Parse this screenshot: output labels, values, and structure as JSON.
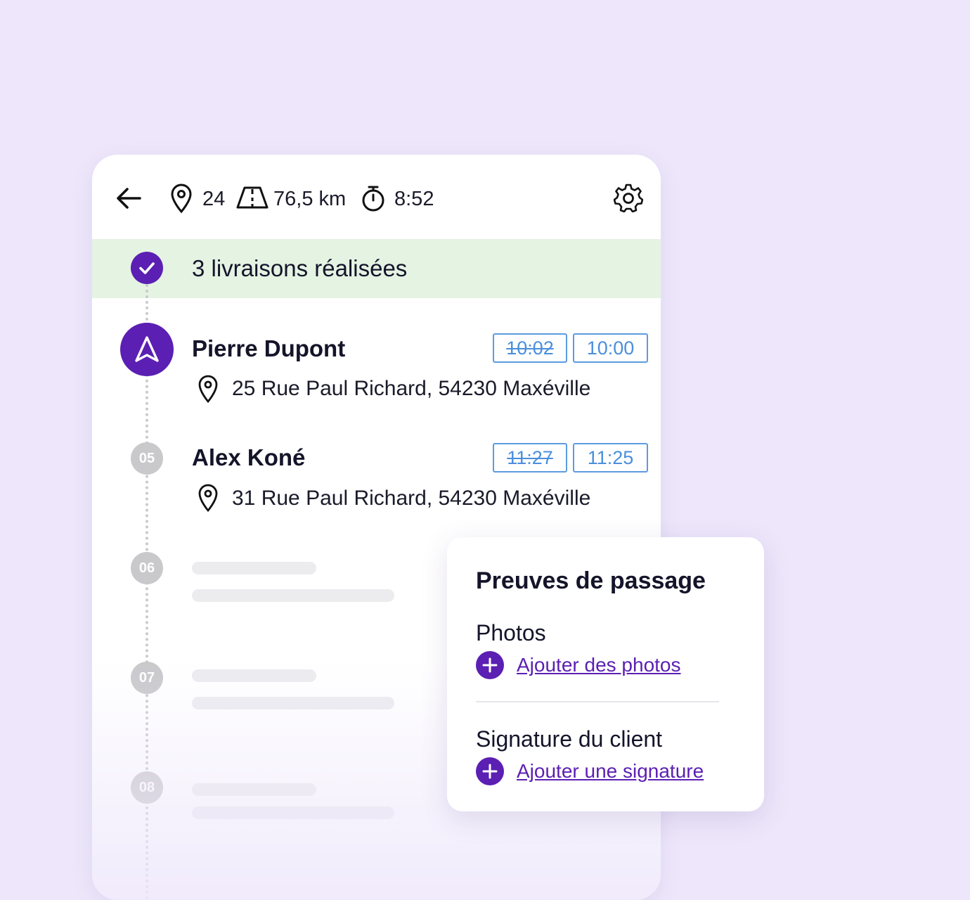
{
  "header": {
    "back_icon": "arrow-left-icon",
    "stops_count": "24",
    "distance": "76,5 km",
    "duration": "8:52",
    "settings_icon": "gear-icon"
  },
  "completed_banner": {
    "text": "3 livraisons réalisées"
  },
  "stops": [
    {
      "name": "Pierre Dupont",
      "address": "25 Rue Paul Richard, 54230 Maxéville",
      "time_planned": "10:02",
      "time_estimated": "10:00",
      "status": "current"
    },
    {
      "number": "05",
      "name": "Alex Koné",
      "address": "31 Rue Paul Richard, 54230 Maxéville",
      "time_planned": "11:27",
      "time_estimated": "11:25"
    },
    {
      "number": "06"
    },
    {
      "number": "07"
    },
    {
      "number": "08"
    }
  ],
  "proof_card": {
    "title": "Preuves de passage",
    "photos_label": "Photos",
    "photos_action": "Ajouter des photos",
    "signature_label": "Signature du client",
    "signature_action": "Ajouter une signature"
  },
  "colors": {
    "background": "#EEE7FB",
    "accent": "#5B1FB3",
    "banner": "#E5F3E3",
    "time_badge": "#4A8FDB"
  }
}
